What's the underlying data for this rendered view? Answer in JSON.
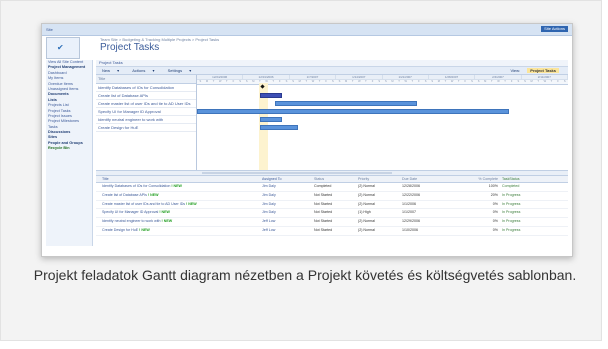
{
  "app": {
    "site_label": "Site",
    "site_actions": "Site Actions",
    "breadcrumb": "Team Site > Budgeting & Tracking Multiple Projects > Project Tasks",
    "page_title": "Project Tasks"
  },
  "left_nav": {
    "items": [
      {
        "label": "View All Site Content",
        "type": "link"
      },
      {
        "label": "Project Management",
        "type": "heading"
      },
      {
        "label": "Dashboard",
        "type": "link"
      },
      {
        "label": "My Items",
        "type": "link"
      },
      {
        "label": "Overdue Items",
        "type": "link"
      },
      {
        "label": "Unassigned Items",
        "type": "link"
      },
      {
        "label": "Documents",
        "type": "heading"
      },
      {
        "label": "Lists",
        "type": "heading"
      },
      {
        "label": "Projects List",
        "type": "link"
      },
      {
        "label": "Project Tasks",
        "type": "link"
      },
      {
        "label": "Project Issues",
        "type": "link"
      },
      {
        "label": "Project Milestones",
        "type": "link"
      },
      {
        "label": "Tasks",
        "type": "link"
      },
      {
        "label": "Discussions",
        "type": "heading"
      },
      {
        "label": "Sites",
        "type": "heading"
      },
      {
        "label": "People and Groups",
        "type": "heading"
      },
      {
        "label": "Recycle Bin",
        "type": "bin"
      }
    ]
  },
  "view_tab": "Project Tasks",
  "toolbar": {
    "new_label": "New",
    "actions_label": "Actions",
    "settings_label": "Settings",
    "view_label": "View:",
    "view_value": "Project Tasks"
  },
  "gantt": {
    "list_header": "Title",
    "weeks": [
      "12/24/2006",
      "12/31/2006",
      "1/7/2007",
      "1/14/2007",
      "1/21/2007",
      "1/28/2007",
      "2/4/2007",
      "2/11/2007"
    ],
    "day_letters": [
      "S",
      "M",
      "T",
      "W",
      "T",
      "F",
      "S"
    ]
  },
  "table": {
    "columns": [
      "Title",
      "Assigned To",
      "Status",
      "Priority",
      "Due Date",
      "% Complete",
      "TaskStatus"
    ],
    "new_tag": "! NEW",
    "rows": [
      {
        "title": "Identify Databases of IOs for Consolidation",
        "assigned": "Jim Daly",
        "status": "Completed",
        "priority": "(2) Normal",
        "due": "12/28/2006",
        "pct": "100%",
        "taskstatus": "Completed"
      },
      {
        "title": "Create list of Database APIs",
        "assigned": "Jim Daly",
        "status": "Not Started",
        "priority": "(2) Normal",
        "due": "12/22/2006",
        "pct": "20%",
        "taskstatus": "In Progress"
      },
      {
        "title": "Create master list of user IDs and tie to AD User IDs",
        "assigned": "Jim Daly",
        "status": "Not Started",
        "priority": "(2) Normal",
        "due": "1/1/2006",
        "pct": "0%",
        "taskstatus": "In Progress"
      },
      {
        "title": "Specify UI for Manager ID Approval",
        "assigned": "Jim Daly",
        "status": "Not Started",
        "priority": "(1) High",
        "due": "1/1/2007",
        "pct": "0%",
        "taskstatus": "In Progress"
      },
      {
        "title": "Identify neutral engineer to work with",
        "assigned": "Jeff Low",
        "status": "Not Started",
        "priority": "(2) Normal",
        "due": "12/29/2006",
        "pct": "0%",
        "taskstatus": "In Progress"
      },
      {
        "title": "Create Design for HuE",
        "assigned": "Jeff Low",
        "status": "Not Started",
        "priority": "(2) Normal",
        "due": "1/10/2006",
        "pct": "0%",
        "taskstatus": "In Progress"
      }
    ]
  },
  "caption": "Projekt feladatok Gantt diagram nézetben a Projekt követés és költségvetés sablonban.",
  "colors": {
    "accent": "#2f65b0",
    "bar": "#5a93db",
    "bar_done": "#3d4fb5",
    "today": "#fdf3cf"
  }
}
